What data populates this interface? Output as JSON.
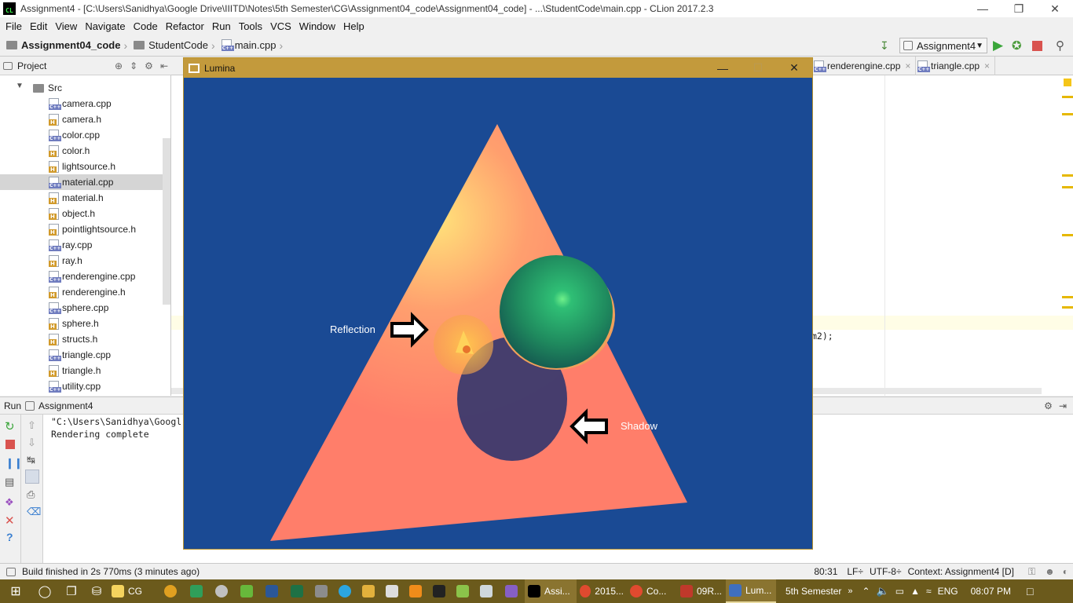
{
  "window": {
    "title": "Assignment4 - [C:\\Users\\Sanidhya\\Google Drive\\IIITD\\Notes\\5th Semester\\CG\\Assignment04_code\\Assignment04_code] - ...\\StudentCode\\main.cpp - CLion 2017.2.3",
    "app_icon_text": "CL"
  },
  "menu": [
    "File",
    "Edit",
    "View",
    "Navigate",
    "Code",
    "Refactor",
    "Run",
    "Tools",
    "VCS",
    "Window",
    "Help"
  ],
  "breadcrumb": [
    "Assignment04_code",
    "StudentCode",
    "main.cpp"
  ],
  "run_config": "Assignment4",
  "project": {
    "header": "Project",
    "folder": "Src",
    "files": [
      {
        "name": "camera.cpp",
        "type": "cpp"
      },
      {
        "name": "camera.h",
        "type": "h"
      },
      {
        "name": "color.cpp",
        "type": "cpp"
      },
      {
        "name": "color.h",
        "type": "h"
      },
      {
        "name": "lightsource.h",
        "type": "h"
      },
      {
        "name": "material.cpp",
        "type": "cpp",
        "selected": true
      },
      {
        "name": "material.h",
        "type": "h"
      },
      {
        "name": "object.h",
        "type": "h"
      },
      {
        "name": "pointlightsource.h",
        "type": "h"
      },
      {
        "name": "ray.cpp",
        "type": "cpp"
      },
      {
        "name": "ray.h",
        "type": "h"
      },
      {
        "name": "renderengine.cpp",
        "type": "cpp"
      },
      {
        "name": "renderengine.h",
        "type": "h"
      },
      {
        "name": "sphere.cpp",
        "type": "cpp"
      },
      {
        "name": "sphere.h",
        "type": "h"
      },
      {
        "name": "structs.h",
        "type": "h"
      },
      {
        "name": "triangle.cpp",
        "type": "cpp"
      },
      {
        "name": "triangle.h",
        "type": "h"
      },
      {
        "name": "utility.cpp",
        "type": "cpp"
      }
    ]
  },
  "editor": {
    "tabs": [
      "renderengine.cpp",
      "triangle.cpp"
    ],
    "visible_code": "m2);"
  },
  "run": {
    "tab_label": "Run",
    "config": "Assignment4",
    "console": [
      "\"C:\\Users\\Sanidhya\\Googl",
      "Rendering complete"
    ]
  },
  "status": {
    "message": "Build finished in 2s 770ms (3 minutes ago)",
    "position": "80:31",
    "line_sep": "LF÷",
    "encoding": "UTF-8÷",
    "context": "Context: Assignment4 [D]"
  },
  "lumina": {
    "title": "Lumina",
    "label_reflection": "Reflection",
    "label_shadow": "Shadow",
    "colors": {
      "background": "#1a4a94",
      "triangle": "#ff7e6a",
      "sphere": "#1f8a5e",
      "shadow": "#3c3a6e"
    }
  },
  "taskbar": {
    "items": [
      {
        "label": "CG",
        "color": "#f4d35e"
      },
      {
        "label": "Assi...",
        "color": "#000000"
      },
      {
        "label": "2015...",
        "color": "#e04a2f"
      },
      {
        "label": "Co...",
        "color": "#e04a2f"
      },
      {
        "label": "09R...",
        "color": "#c0392b"
      },
      {
        "label": "Lum...",
        "color": "#3f6fbf"
      }
    ],
    "tray_folder": "5th Semester",
    "lang": "ENG",
    "time": "08:07 PM"
  }
}
